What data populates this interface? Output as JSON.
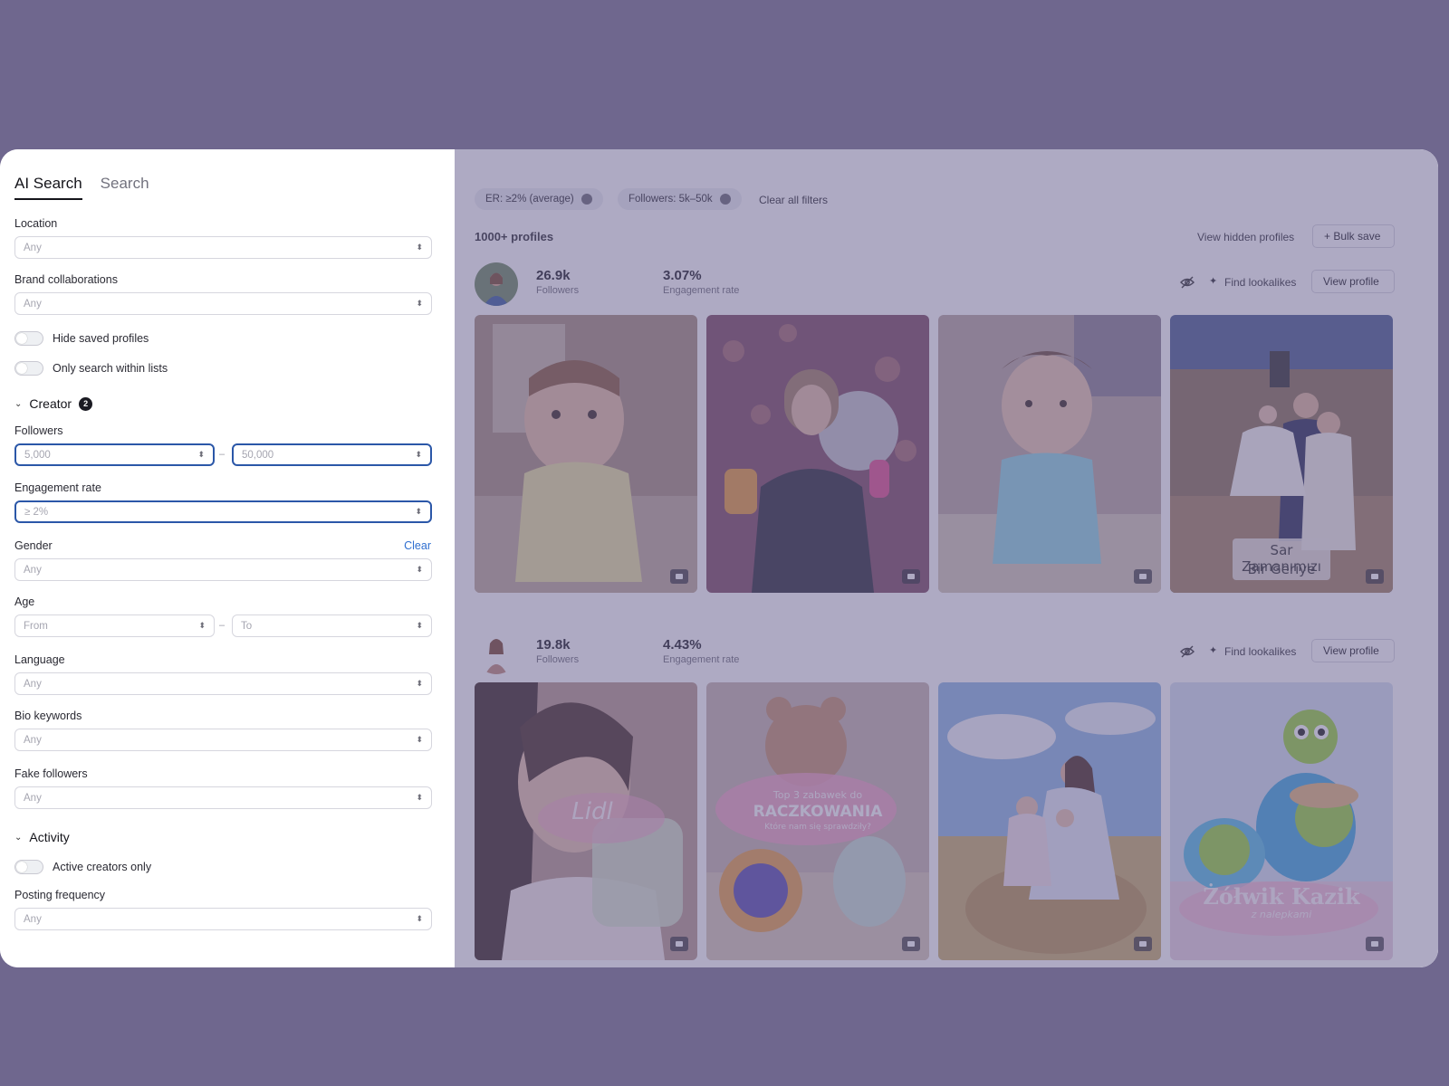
{
  "sidebar": {
    "tabs": [
      "AI Search",
      "Search"
    ],
    "location": {
      "label": "Location",
      "value": "Any"
    },
    "brand": {
      "label": "Brand collaborations",
      "value": "Any"
    },
    "toggles": {
      "hide_saved": "Hide saved profiles",
      "within_lists": "Only search within lists"
    },
    "creator_section": {
      "label": "Creator",
      "badge": "2"
    },
    "followers": {
      "label": "Followers",
      "from": "5,000",
      "to": "50,000"
    },
    "engagement": {
      "label": "Engagement rate",
      "value": "≥ 2%"
    },
    "gender": {
      "label": "Gender",
      "clear": "Clear",
      "value": "Any"
    },
    "age": {
      "label": "Age",
      "from": "From",
      "to": "To"
    },
    "language": {
      "label": "Language",
      "value": "Any"
    },
    "bio": {
      "label": "Bio keywords",
      "value": "Any"
    },
    "fake": {
      "label": "Fake followers",
      "value": "Any"
    },
    "activity_section": {
      "label": "Activity"
    },
    "active_only": "Active creators only",
    "posting": {
      "label": "Posting frequency",
      "value": "Any"
    },
    "dash": "–"
  },
  "main": {
    "chips": [
      "ER: ≥2% (average)",
      "Followers: 5k–50k"
    ],
    "clear_all": "Clear all filters",
    "count": "1000+ profiles",
    "view_hidden": "View hidden profiles",
    "bulk_save": "+ Bulk save",
    "find_lookalikes": "Find lookalikes",
    "view_profile": "View profile",
    "profiles": [
      {
        "followers": "26.9k",
        "followers_label": "Followers",
        "er": "3.07%",
        "er_label": "Engagement rate"
      },
      {
        "followers": "19.8k",
        "followers_label": "Followers",
        "er": "4.43%",
        "er_label": "Engagement rate"
      }
    ],
    "captions": {
      "p1_t4_line1": "Sar Zamanımızı",
      "p1_t4_line2": "Bir Geriye",
      "p2_t1": "Lidl",
      "p2_t2_line1": "Top 3 zabawek do",
      "p2_t2_line2": "RACZKOWANIA",
      "p2_t2_line3": "Które nam się sprawdziły?",
      "p2_t4_line1": "Żółwik Kazik",
      "p2_t4_line2": "z nalepkami"
    }
  },
  "colors": {
    "backdrop": "#6f678e",
    "accent": "#2b57a8",
    "link": "#2f6fd0"
  }
}
